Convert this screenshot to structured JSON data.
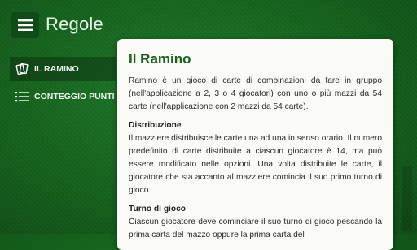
{
  "header": {
    "title": "Regole"
  },
  "sidebar": {
    "items": [
      {
        "label": "IL RAMINO",
        "icon": "cards-icon",
        "active": true
      },
      {
        "label": "CONTEGGIO PUNTI",
        "icon": "list-icon",
        "active": false
      }
    ]
  },
  "content": {
    "title": "Il Ramino",
    "intro": "Ramino è un gioco di carte di combinazioni da fare in gruppo (nell'applicazione a 2, 3 o 4 giocatori) con uno o più mazzi da 54 carte (nell'applicazione con 2 mazzi da 54 carte).",
    "sections": [
      {
        "heading": "Distribuzione",
        "text": "Il mazziere distribuisce le carte una ad una in senso orario. Il numero predefinito di carte distribuite a ciascun giocatore è 14, ma può essere modificato nelle opzioni. Una volta distribuite le carte, il giocatore che sta accanto al mazziere comincia il suo primo turno di gioco."
      },
      {
        "heading": "Turno di gioco",
        "text": "Ciascun giocatore deve cominciare il suo turno di gioco pescando la prima carta del mazzo oppure la prima carta del"
      }
    ]
  },
  "colors": {
    "accent": "#1b5e20",
    "background": "#17661f",
    "card": "#fafbf7"
  }
}
